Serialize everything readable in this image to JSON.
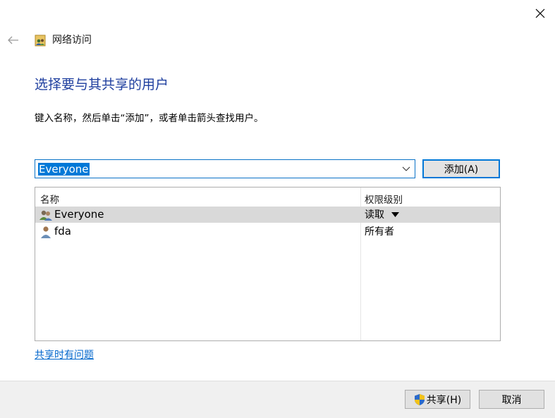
{
  "nav": {
    "title": "网络访问"
  },
  "heading": "选择要与其共享的用户",
  "instruction": "键入名称，然后单击“添加”，或者单击箭头查找用户。",
  "combo": {
    "value": "Everyone"
  },
  "buttons": {
    "add": "添加(A)",
    "share": "共享(H)",
    "cancel": "取消"
  },
  "list": {
    "headers": {
      "name": "名称",
      "permission": "权限级别"
    },
    "rows": [
      {
        "name": "Everyone",
        "permission": "读取",
        "icon": "group-icon",
        "selected": true
      },
      {
        "name": "fda",
        "permission": "所有者",
        "icon": "user-icon",
        "selected": false
      }
    ]
  },
  "help_link": "共享时有问题",
  "icons": {
    "close": "close-icon",
    "back": "back-arrow-icon",
    "nav": "network-share-icon",
    "shield": "uac-shield-icon"
  },
  "colors": {
    "heading": "#1f3f9f",
    "link": "#0066cc",
    "accent": "#0078d7",
    "selected_row": "#d9d9d9"
  }
}
